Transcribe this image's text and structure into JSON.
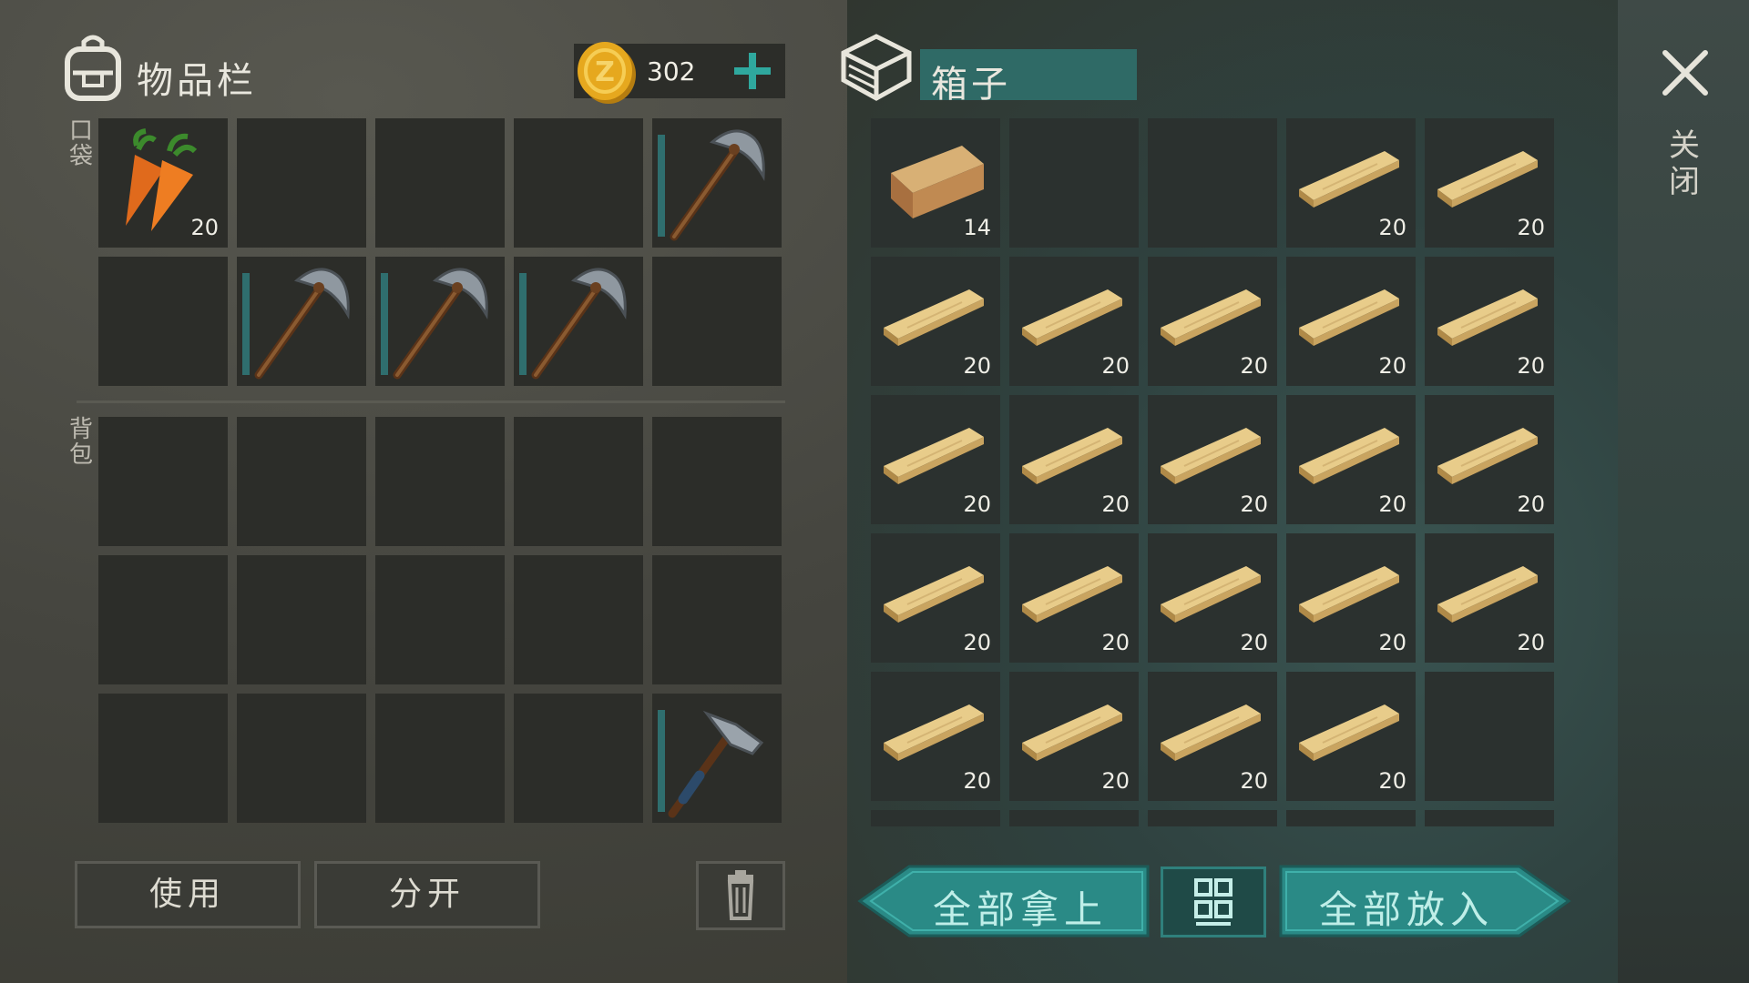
{
  "inventory": {
    "title": "物品栏",
    "coins": "302",
    "pocket_label": "口袋",
    "backpack_label": "背包",
    "pocket_slots": [
      {
        "item": "carrot",
        "count": "20"
      },
      {
        "item": "",
        "count": ""
      },
      {
        "item": "",
        "count": ""
      },
      {
        "item": "",
        "count": ""
      },
      {
        "item": "pickaxe",
        "count": ""
      },
      {
        "item": "",
        "count": ""
      },
      {
        "item": "pickaxe",
        "count": ""
      },
      {
        "item": "pickaxe",
        "count": ""
      },
      {
        "item": "pickaxe",
        "count": ""
      },
      {
        "item": "",
        "count": ""
      }
    ],
    "backpack_slots": [
      {
        "item": "",
        "count": ""
      },
      {
        "item": "",
        "count": ""
      },
      {
        "item": "",
        "count": ""
      },
      {
        "item": "",
        "count": ""
      },
      {
        "item": "",
        "count": ""
      },
      {
        "item": "",
        "count": ""
      },
      {
        "item": "",
        "count": ""
      },
      {
        "item": "",
        "count": ""
      },
      {
        "item": "",
        "count": ""
      },
      {
        "item": "",
        "count": ""
      },
      {
        "item": "",
        "count": ""
      },
      {
        "item": "",
        "count": ""
      },
      {
        "item": "",
        "count": ""
      },
      {
        "item": "",
        "count": ""
      },
      {
        "item": "hatchet",
        "count": ""
      }
    ],
    "use_label": "使用",
    "split_label": "分开"
  },
  "chest": {
    "title": "箱子",
    "slots": [
      {
        "item": "log",
        "count": "14"
      },
      {
        "item": "",
        "count": ""
      },
      {
        "item": "",
        "count": ""
      },
      {
        "item": "plank",
        "count": "20"
      },
      {
        "item": "plank",
        "count": "20"
      },
      {
        "item": "plank",
        "count": "20"
      },
      {
        "item": "plank",
        "count": "20"
      },
      {
        "item": "plank",
        "count": "20"
      },
      {
        "item": "plank",
        "count": "20"
      },
      {
        "item": "plank",
        "count": "20"
      },
      {
        "item": "plank",
        "count": "20"
      },
      {
        "item": "plank",
        "count": "20"
      },
      {
        "item": "plank",
        "count": "20"
      },
      {
        "item": "plank",
        "count": "20"
      },
      {
        "item": "plank",
        "count": "20"
      },
      {
        "item": "plank",
        "count": "20"
      },
      {
        "item": "plank",
        "count": "20"
      },
      {
        "item": "plank",
        "count": "20"
      },
      {
        "item": "plank",
        "count": "20"
      },
      {
        "item": "plank",
        "count": "20"
      },
      {
        "item": "plank",
        "count": "20"
      },
      {
        "item": "plank",
        "count": "20"
      },
      {
        "item": "plank",
        "count": "20"
      },
      {
        "item": "plank",
        "count": "20"
      },
      {
        "item": "",
        "count": ""
      }
    ],
    "take_all_label": "全部拿上",
    "put_all_label": "全部放入"
  },
  "close_label": "关闭",
  "icons": {
    "backpack": "backpack-icon",
    "coin": "coin-icon",
    "add": "plus-icon",
    "chest": "chest-icon",
    "close": "close-icon",
    "trash": "trash-icon",
    "sort": "sort-grid-icon"
  },
  "colors": {
    "teal_button": "#2a8a86",
    "teal_header": "#2f6a66",
    "coin": "#e0a21a",
    "plus": "#2fa89e"
  }
}
